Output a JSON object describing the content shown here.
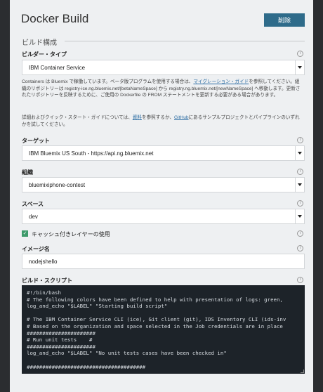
{
  "header": {
    "title": "Docker Build",
    "delete_label": "削除"
  },
  "section": {
    "title": "ビルド構成"
  },
  "builder_type": {
    "label": "ビルダー・タイプ",
    "value": "IBM Container Service"
  },
  "description": {
    "text1": "Containers は Bluemix で稼働しています。ベータ版プログラムを使用する場合は、",
    "link1": "マイグレーション・ガイド",
    "text2": "を参照してください。組織のリポジトリーは registry-ice.ng.bluemix.net/[betaNameSpace] から registry.ng.bluemix.net/[newNameSpace] へ移動します。更新されたリポジトリーを反映するために、ご使用の Dockerfile の FROM ステートメントを更新する必要がある場合があります。",
    "text3": "詳細およびクイック・スタート・ガイドについては、",
    "link2": "資料",
    "text4": "を参照するか、",
    "link3": "GitHub",
    "text5": "にあるサンプルプロジェクトとパイプラインのいずれかを試してください。"
  },
  "target": {
    "label": "ターゲット",
    "value": "IBM Bluemix US South - https://api.ng.bluemix.net"
  },
  "organization": {
    "label": "組織",
    "value": "bluemixiphone-contest"
  },
  "space": {
    "label": "スペース",
    "value": "dev"
  },
  "cache": {
    "label": "キャッシュ付きレイヤーの使用",
    "checked": true
  },
  "image_name": {
    "label": "イメージ名",
    "value": "nodejshello"
  },
  "build_script": {
    "label": "ビルド・スクリプト",
    "content": "#!/bin/bash\n# The following colors have been defined to help with presentation of logs: green, \nlog_and_echo \"$LABEL\" \"Starting build script\"\n\n# The IBM Container Service CLI (ice), Git client (git), IDS Inventory CLI (ids-inv\n# Based on the organization and space selected in the Job credentials are in place\n######################\n# Run unit tests    #\n######################\nlog_and_echo \"$LABEL\" \"No unit tests cases have been checked in\"\n\n######################################"
  },
  "icons": {
    "info": "info-icon",
    "dropdown": "chevron-down-icon",
    "check": "checkmark-icon"
  },
  "colors": {
    "accent": "#2e6b8a",
    "checkbox": "#3d9a6a",
    "link": "#2b6ca3",
    "code_bg": "#1d2329"
  }
}
